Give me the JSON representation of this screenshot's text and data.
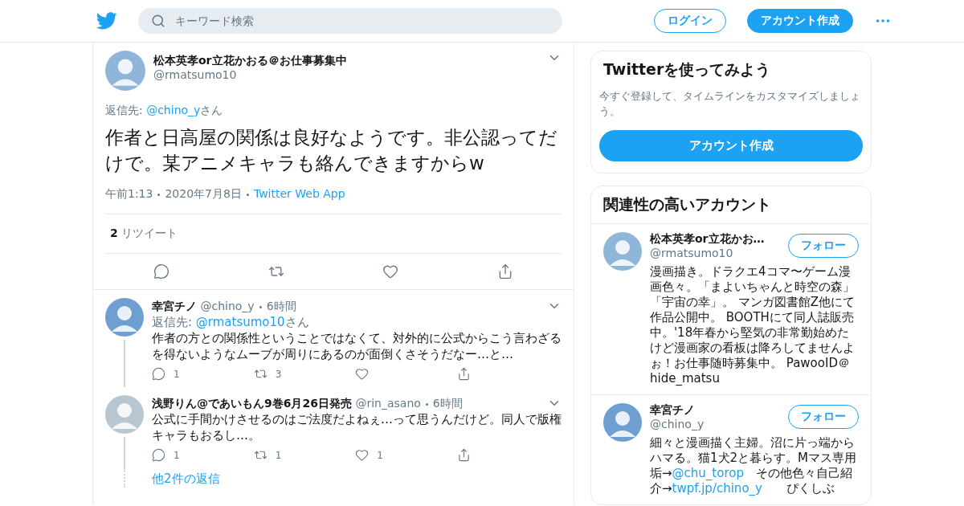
{
  "header": {
    "search": {
      "placeholder": "キーワード検索"
    },
    "login": "ログイン",
    "signup": "アカウント作成"
  },
  "main_tweet": {
    "name": "松本英孝or立花かおる＠お仕事募集中",
    "handle": "@rmatsumo10",
    "reply_label": "返信先:",
    "reply_to": "@chino_y",
    "reply_suffix": "さん",
    "text": "作者と日高屋の関係は良好なようです。非公認ってだけで。某アニメキャラも絡んできますからw",
    "time": "午前1:13",
    "date": "2020年7月8日",
    "source": "Twitter Web App",
    "retweet_count": "2",
    "retweet_label": "リツイート",
    "actions": [
      {
        "kind": "reply"
      },
      {
        "kind": "retweet"
      },
      {
        "kind": "like"
      },
      {
        "kind": "share"
      }
    ]
  },
  "replies": [
    {
      "name": "幸宮チノ",
      "handle": "@chino_y",
      "age": "6時間",
      "reply_label": "返信先:",
      "reply_to": "@rmatsumo10",
      "reply_suffix": "さん",
      "text": "作者の方との関係性ということではなくて、対外的に公式からこう言わざるを得ないようなムーブが周りにあるのが面倒くさそうだなー…と…",
      "actions": [
        {
          "kind": "reply",
          "count": "1"
        },
        {
          "kind": "retweet",
          "count": "3"
        },
        {
          "kind": "like"
        },
        {
          "kind": "share"
        }
      ]
    },
    {
      "name": "浅野りん@であいもん9巻6月26日発売",
      "handle": "@rin_asano",
      "age": "6時間",
      "text": "公式に手間かけさせるのはご法度だよねぇ…って思うんだけど。同人で版権キャラもおるし…。",
      "actions": [
        {
          "kind": "reply",
          "count": "1"
        },
        {
          "kind": "retweet",
          "count": "1"
        },
        {
          "kind": "like",
          "count": "1"
        },
        {
          "kind": "share"
        }
      ]
    }
  ],
  "more_replies": "他2件の返信",
  "signup_card": {
    "title": "Twitterを使ってみよう",
    "text": "今すぐ登録して、タイムラインをカスタマイズしましょう。",
    "button": "アカウント作成"
  },
  "related": {
    "title": "関連性の高いアカウント",
    "accounts": [
      {
        "name": "松本英孝or立花かお…",
        "handle": "@rmatsumo10",
        "follow": "フォロー",
        "bio": [
          {
            "text": "漫画描き。ドラクエ4コマ〜ゲーム漫画色々。「まよいちゃんと時空の森」「宇宙の幸」。 マンガ図書館Z他にて作品公開中。 BOOTHにて同人誌販売中。'18年春から堅気の非常勤始めたけど漫画家の看板は降ろしてませんよぉ！お仕事随時募集中。 PawooID＠hide_matsu",
            "link": false
          }
        ]
      },
      {
        "name": "幸宮チノ",
        "handle": "@chino_y",
        "follow": "フォロー",
        "bio": [
          {
            "text": "細々と漫画描く主婦。沼に片っ端からハマる。猫1犬2と暮らす。Mマス専用垢→",
            "link": false
          },
          {
            "text": "@chu_torop",
            "link": true
          },
          {
            "text": "　その他色々自己紹介→",
            "link": false
          },
          {
            "text": "twpf.jp/chino_y",
            "link": true
          },
          {
            "text": "　　ぴくしぶ",
            "link": false
          }
        ]
      }
    ]
  }
}
